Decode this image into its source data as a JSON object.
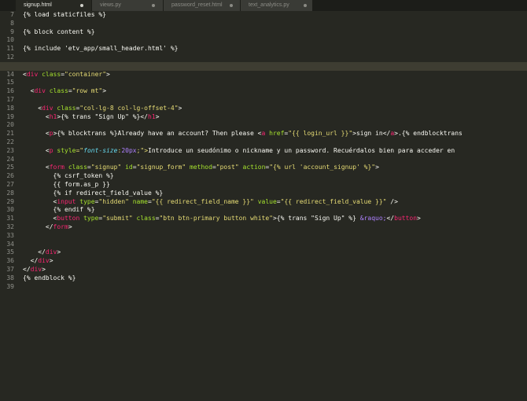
{
  "tabs": [
    {
      "label": "signup.html",
      "active": true
    },
    {
      "label": "views.py",
      "active": false
    },
    {
      "label": "password_reset.html",
      "active": false
    },
    {
      "label": "text_analytics.py",
      "active": false
    }
  ],
  "line_numbers": [
    "7",
    "8",
    "9",
    "10",
    "11",
    "12",
    "13",
    "14",
    "15",
    "16",
    "17",
    "18",
    "19",
    "20",
    "21",
    "22",
    "23",
    "24",
    "25",
    "26",
    "27",
    "28",
    "29",
    "30",
    "31",
    "32",
    "33",
    "34",
    "35",
    "36",
    "37",
    "38",
    "39"
  ],
  "code": {
    "l7": [
      "{% load staticfiles %}"
    ],
    "l9": [
      "{% block content %}"
    ],
    "l11": [
      "{% include 'etv_app/small_header.html' %}"
    ],
    "l14": [
      "<",
      "div",
      " ",
      "class",
      "=",
      "\"container\"",
      ">"
    ],
    "l16": [
      "<",
      "div",
      " ",
      "class",
      "=",
      "\"row mt\"",
      ">"
    ],
    "l18": [
      "<",
      "div",
      " ",
      "class",
      "=",
      "\"col-lg-8 col-lg-offset-4\"",
      ">"
    ],
    "l19": [
      "<",
      "h1",
      ">",
      "{% trans \"Sign Up\" %}",
      "</",
      "h1",
      ">"
    ],
    "l21": [
      "<",
      "p",
      ">",
      "{% blocktrans %}Already have an account? Then please ",
      "<",
      "a",
      " ",
      "href",
      "=",
      "\"{{ login_url }}\"",
      ">",
      "sign in",
      "</",
      "a",
      ">",
      ".{% endblocktrans"
    ],
    "l23": [
      "<",
      "p",
      " ",
      "style",
      "=\"",
      "font-size",
      ":",
      "20px",
      ";\">",
      "Introduce un seudónimo o nickname y un password. Recuérdalos bien para acceder en"
    ],
    "l25": [
      "<",
      "form",
      " ",
      "class",
      "=",
      "\"signup\"",
      " ",
      "id",
      "=",
      "\"signup_form\"",
      " ",
      "method",
      "=",
      "\"post\"",
      " ",
      "action",
      "=",
      "\"{% url 'account_signup' %}\"",
      ">"
    ],
    "l26": [
      "{% csrf_token %}"
    ],
    "l27": [
      "{{ form.as_p }}"
    ],
    "l28": [
      "{% if redirect_field_value %}"
    ],
    "l29": [
      "<",
      "input",
      " ",
      "type",
      "=",
      "\"hidden\"",
      " ",
      "name",
      "=",
      "\"{{ redirect_field_name }}\"",
      " ",
      "value",
      "=",
      "\"{{ redirect_field_value }}\"",
      " />"
    ],
    "l30": [
      "{% endif %}"
    ],
    "l31": [
      "<",
      "button",
      " ",
      "type",
      "=",
      "\"submit\"",
      " ",
      "class",
      "=",
      "\"btn btn-primary button white\"",
      ">",
      "{% trans \"Sign Up\" %} ",
      "&raquo;",
      "</",
      "button",
      ">"
    ],
    "l32": [
      "</",
      "form",
      ">"
    ],
    "l35": [
      "</",
      "div",
      ">"
    ],
    "l36": [
      "</",
      "div",
      ">"
    ],
    "l37": [
      "</",
      "div",
      ">"
    ],
    "l38": [
      "{% endblock %}"
    ]
  },
  "colors": {
    "background": "#272822",
    "tag": "#f92672",
    "attribute": "#a6e22e",
    "string": "#e6db74",
    "entity": "#ae81ff",
    "css_property": "#66d9ef",
    "text": "#f8f8f2",
    "line_number": "#8f908a"
  }
}
